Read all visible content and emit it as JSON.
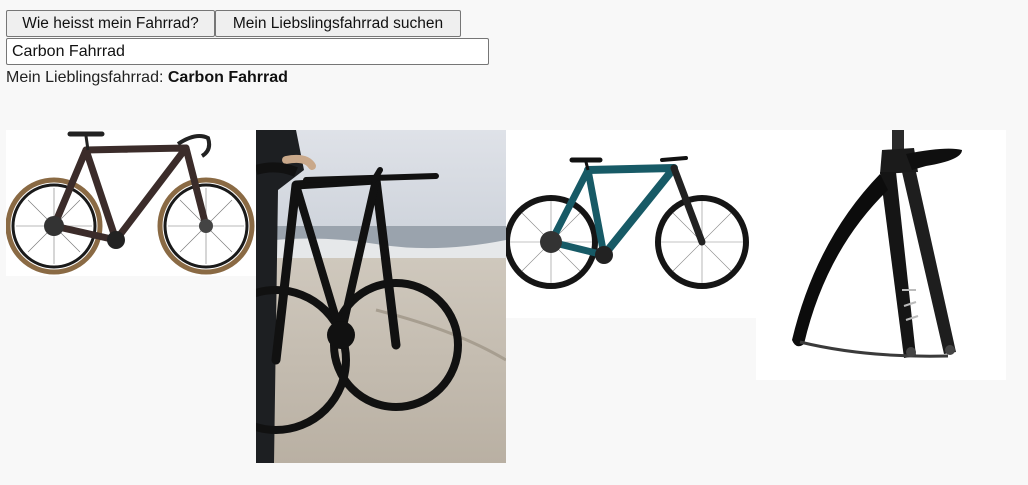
{
  "buttons": {
    "name_bike": "Wie heisst mein Fahrrad?",
    "search_favorite": "Mein Liebslingsfahrrad suchen"
  },
  "search": {
    "value": "Carbon Fahrrad"
  },
  "result": {
    "label": "Mein Lieblingsfahrrad: ",
    "value": "Carbon Fahrrad"
  },
  "images": [
    {
      "icon": "gravel-bike-photo"
    },
    {
      "icon": "beach-bike-photo"
    },
    {
      "icon": "mountain-bike-photo"
    },
    {
      "icon": "bike-fork-photo"
    }
  ]
}
